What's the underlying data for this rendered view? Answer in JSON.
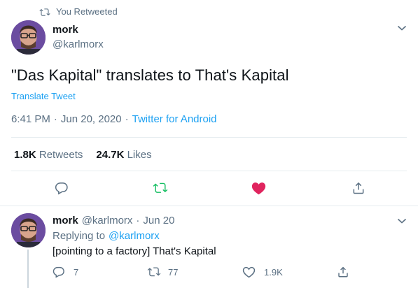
{
  "retweet_header": {
    "text": "You Retweeted"
  },
  "main_tweet": {
    "author_name": "mork",
    "handle": "@karlmorx",
    "text": "\"Das Kapital\" translates to That's Kapital",
    "translate_label": "Translate Tweet",
    "time": "6:41 PM",
    "separator": "·",
    "date": "Jun 20, 2020",
    "separator2": "·",
    "source": "Twitter for Android",
    "stats": {
      "retweets_count": "1.8K",
      "retweets_label": "Retweets",
      "likes_count": "24.7K",
      "likes_label": "Likes"
    }
  },
  "reply": {
    "author_name": "mork",
    "handle": "@karlmorx",
    "separator": "·",
    "date": "Jun 20",
    "replying_to_label": "Replying to",
    "replying_to_handle": "@karlmorx",
    "text": "[pointing to a factory] That's Kapital",
    "reply_count": "7",
    "retweet_count": "77",
    "like_count": "1.9K"
  },
  "colors": {
    "accent": "#1da1f2",
    "retweet_active": "#17bf63",
    "like_active": "#e0245e",
    "secondary_text": "#5b7083",
    "avatar_bg": "#6b4ca0"
  },
  "icons": {
    "retweet_header": "retweet-icon",
    "caret": "chevron-down-icon",
    "reply": "reply-icon",
    "retweet": "retweet-icon",
    "like": "heart-icon",
    "share": "share-icon"
  }
}
